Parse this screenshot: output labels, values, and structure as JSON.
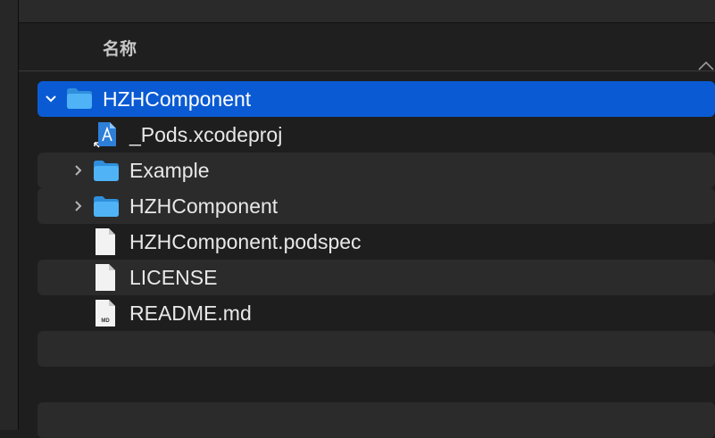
{
  "header": {
    "column_label": "名称"
  },
  "rows": [
    {
      "label": "HZHComponent",
      "icon": "folder-icon",
      "level": 0,
      "expanded": true,
      "selected": true
    },
    {
      "label": "_Pods.xcodeproj",
      "icon": "xcodeproj-file-icon",
      "level": 1
    },
    {
      "label": "Example",
      "icon": "folder-icon",
      "level": 1,
      "expanded": false
    },
    {
      "label": "HZHComponent",
      "icon": "folder-icon",
      "level": 1,
      "expanded": false
    },
    {
      "label": "HZHComponent.podspec",
      "icon": "document-icon",
      "level": 1
    },
    {
      "label": "LICENSE",
      "icon": "document-icon",
      "level": 1
    },
    {
      "label": "README.md",
      "icon": "markdown-file-icon",
      "level": 1,
      "icon_text": "MD"
    }
  ],
  "colors": {
    "selection": "#0a5bd3",
    "folder": "#3aa6f2",
    "alt_row": "#2b2b2b"
  }
}
